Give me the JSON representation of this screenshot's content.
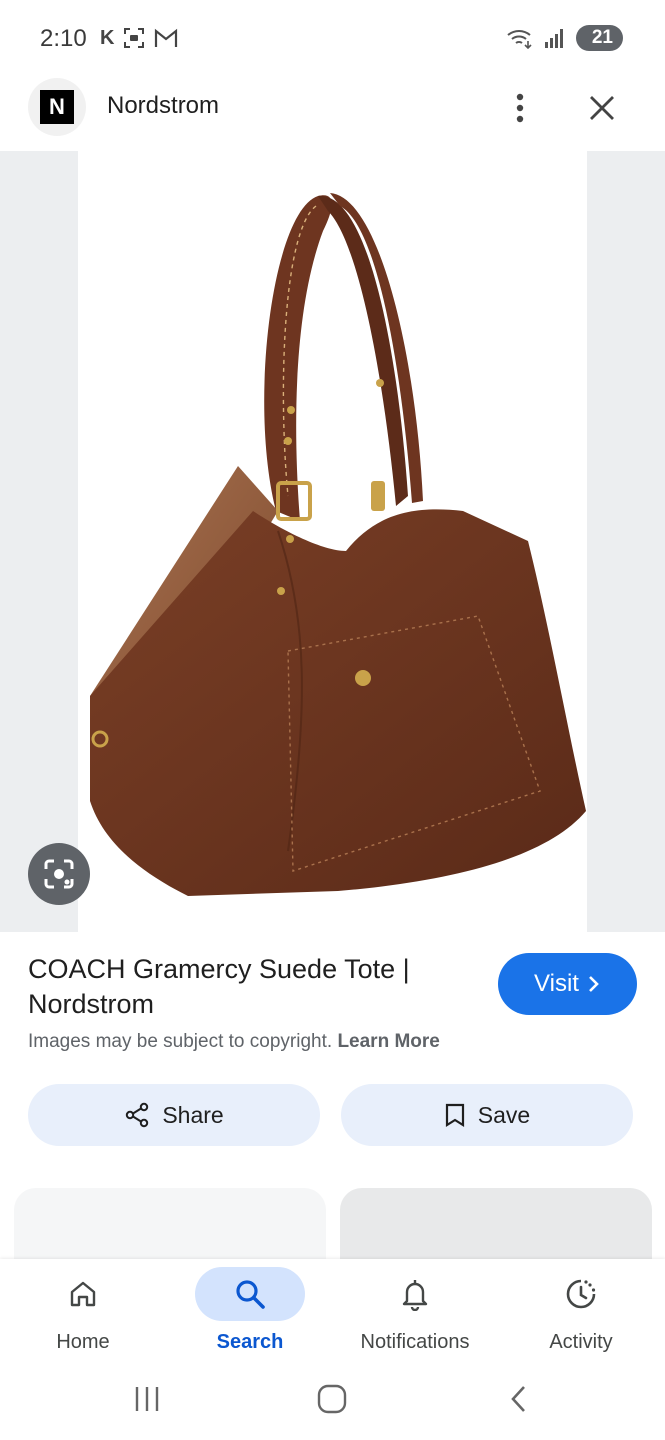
{
  "status_bar": {
    "time": "2:10",
    "battery": "21",
    "icons": [
      "k-app-icon",
      "screenshot-icon",
      "gmail-icon",
      "wifi-icon",
      "signal-icon"
    ]
  },
  "header": {
    "site_icon_letter": "N",
    "site_name": "Nordstrom"
  },
  "product": {
    "title": "COACH Gramercy Suede Tote | Nordstrom",
    "visit_label": "Visit",
    "copyright_text": "Images may be subject to copyright.",
    "learn_more": "Learn More"
  },
  "actions": {
    "share_label": "Share",
    "save_label": "Save"
  },
  "bottom_nav": {
    "items": [
      {
        "label": "Home",
        "icon": "home-icon"
      },
      {
        "label": "Search",
        "icon": "search-icon",
        "active": true
      },
      {
        "label": "Notifications",
        "icon": "bell-icon"
      },
      {
        "label": "Activity",
        "icon": "activity-icon"
      }
    ]
  },
  "colors": {
    "accent": "#1a73e8",
    "active_nav": "#0b57d0",
    "active_pill": "#d3e3fd",
    "action_button": "#e8effb",
    "bag": "#6b3420"
  }
}
